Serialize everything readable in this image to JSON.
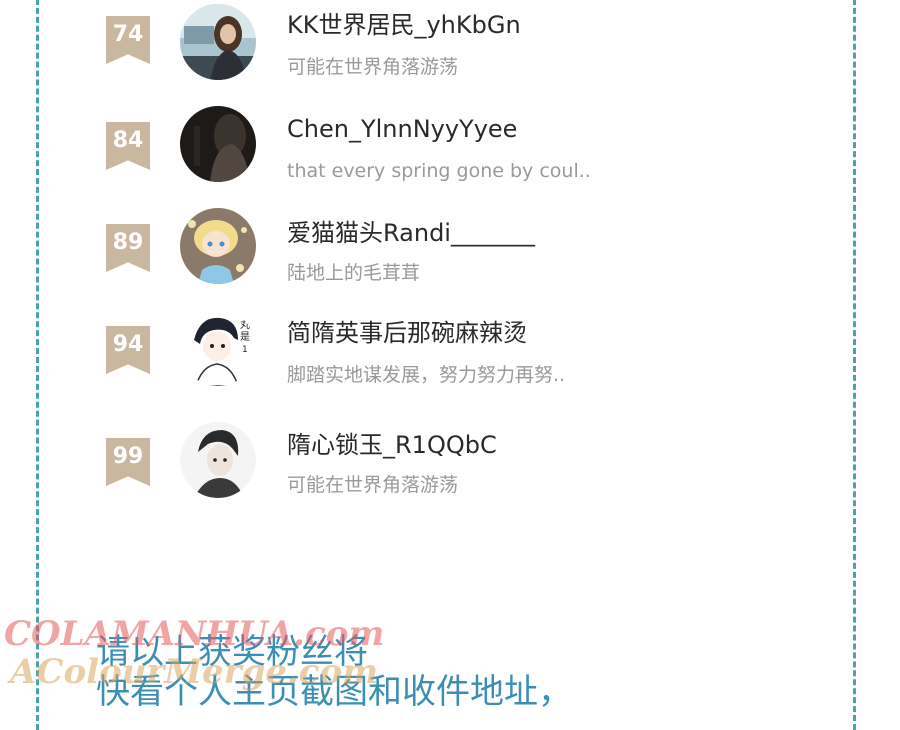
{
  "fans": [
    {
      "rank": "74",
      "name": "KK世界居民_yhKbGn",
      "bio": "可能在世界角落游荡",
      "avatar_icon": "girl-in-window-avatar"
    },
    {
      "rank": "84",
      "name": "Chen_YlnnNyyYyee",
      "bio": "that every spring gone by coul..",
      "avatar_icon": "dark-photo-avatar"
    },
    {
      "rank": "89",
      "name": "爱猫猫头Randi_______",
      "bio": "陆地上的毛茸茸",
      "avatar_icon": "anime-blonde-avatar"
    },
    {
      "rank": "94",
      "name": "简隋英事后那碗麻辣烫",
      "bio": "脚踏实地谋发展，努力努力再努..",
      "avatar_icon": "manga-boy-avatar"
    },
    {
      "rank": "99",
      "name": "隋心锁玉_R1QQbC",
      "bio": "可能在世界角落游荡",
      "avatar_icon": "manga-man-avatar"
    }
  ],
  "footer": {
    "line1": "请以上获奖粉丝将",
    "line2": "快看个人主页截图和收件地址，"
  },
  "watermark": {
    "line1": "COLAMANHUA.com",
    "line2": "AColourMerge.com"
  },
  "colors": {
    "rank_badge": "#c9b79f",
    "border": "#4aa3a8",
    "footer_text": "#3b8fb5",
    "name_text": "#2a2a2a",
    "bio_text": "#9a9a9a"
  }
}
